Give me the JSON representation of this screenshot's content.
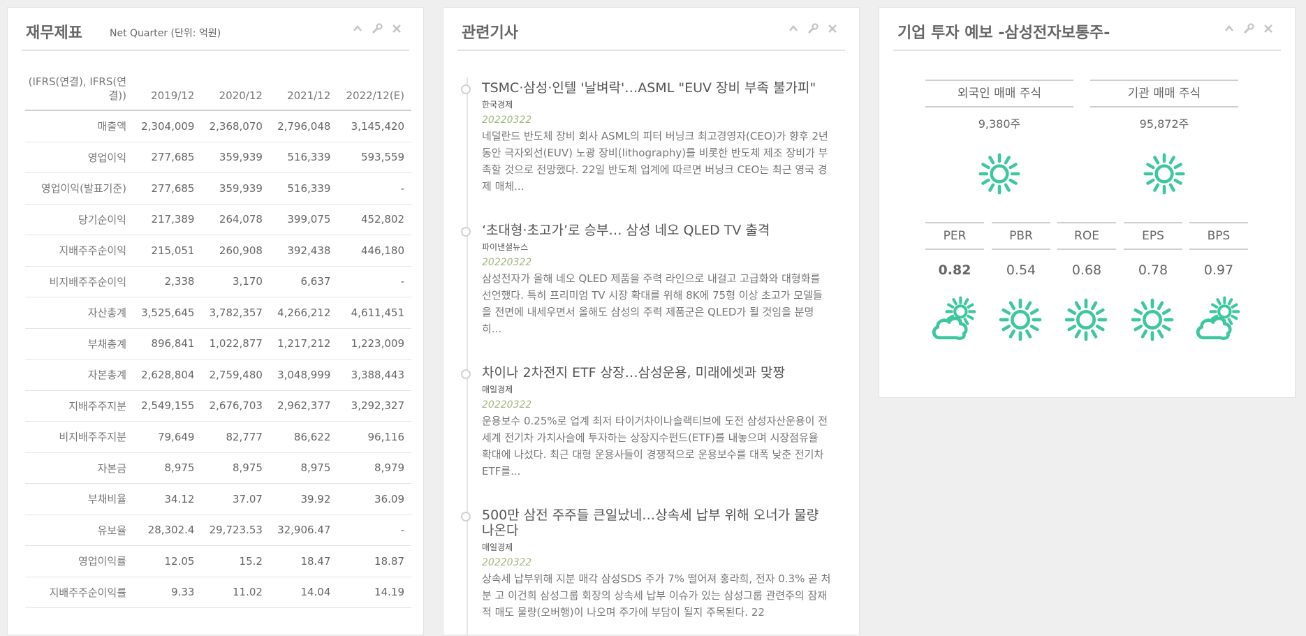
{
  "financial": {
    "title": "재무제표",
    "subtitle": "Net Quarter (단위: 억원)",
    "header_label": "(IFRS(연결), IFRS(연결))",
    "columns": [
      "2019/12",
      "2020/12",
      "2021/12",
      "2022/12(E)"
    ],
    "rows": [
      {
        "label": "매출액",
        "values": [
          "2,304,009",
          "2,368,070",
          "2,796,048",
          "3,145,420"
        ]
      },
      {
        "label": "영업이익",
        "values": [
          "277,685",
          "359,939",
          "516,339",
          "593,559"
        ]
      },
      {
        "label": "영업이익(발표기준)",
        "values": [
          "277,685",
          "359,939",
          "516,339",
          "-"
        ]
      },
      {
        "label": "당기순이익",
        "values": [
          "217,389",
          "264,078",
          "399,075",
          "452,802"
        ]
      },
      {
        "label": "지배주주순이익",
        "values": [
          "215,051",
          "260,908",
          "392,438",
          "446,180"
        ]
      },
      {
        "label": "비지배주주순이익",
        "values": [
          "2,338",
          "3,170",
          "6,637",
          "-"
        ]
      },
      {
        "label": "자산총계",
        "values": [
          "3,525,645",
          "3,782,357",
          "4,266,212",
          "4,611,451"
        ]
      },
      {
        "label": "부채총계",
        "values": [
          "896,841",
          "1,022,877",
          "1,217,212",
          "1,223,009"
        ]
      },
      {
        "label": "자본총계",
        "values": [
          "2,628,804",
          "2,759,480",
          "3,048,999",
          "3,388,443"
        ]
      },
      {
        "label": "지배주주지분",
        "values": [
          "2,549,155",
          "2,676,703",
          "2,962,377",
          "3,292,327"
        ]
      },
      {
        "label": "비지배주주지분",
        "values": [
          "79,649",
          "82,777",
          "86,622",
          "96,116"
        ]
      },
      {
        "label": "자본금",
        "values": [
          "8,975",
          "8,975",
          "8,975",
          "8,979"
        ]
      },
      {
        "label": "부채비율",
        "values": [
          "34.12",
          "37.07",
          "39.92",
          "36.09"
        ]
      },
      {
        "label": "유보율",
        "values": [
          "28,302.4",
          "29,723.53",
          "32,906.47",
          "-"
        ]
      },
      {
        "label": "영업이익률",
        "values": [
          "12.05",
          "15.2",
          "18.47",
          "18.87"
        ]
      },
      {
        "label": "지배주주순이익률",
        "values": [
          "9.33",
          "11.02",
          "14.04",
          "14.19"
        ]
      }
    ]
  },
  "news": {
    "title": "관련기사",
    "items": [
      {
        "title": "TSMC·삼성·인텔 '날벼락'…ASML \"EUV 장비 부족 불가피\"",
        "source": "한국경제",
        "date": "20220322",
        "body": "네덜란드 반도체 장비 회사 ASML의 피터 버닝크 최고경영자(CEO)가 향후 2년 동안 극자외선(EUV) 노광 장비(lithography)를 비롯한 반도체 제조 장비가 부족할 것으로 전망했다. 22일 반도체 업계에 따르면 버닝크 CEO는 최근 영국 경제 매체..."
      },
      {
        "title": "‘초대형·초고가’로 승부… 삼성 네오 QLED TV 출격",
        "source": "파이낸셜뉴스",
        "date": "20220322",
        "body": "삼성전자가 올해 네오 QLED 제품을 주력 라인으로 내걸고 고급화와 대형화를 선언했다. 특히 프리미엄 TV 시장 확대를 위해 8K에 75형 이상 초고가 모델들을 전면에 내세우면서 올해도 삼성의 주력 제품군은 QLED가 될 것임을 분명히..."
      },
      {
        "title": "차이나 2차전지 ETF 상장…삼성운용, 미래에셋과 맞짱",
        "source": "매일경제",
        "date": "20220322",
        "body": "운용보수 0.25%로 업계 최저 타이거차이나솔랙티브에 도전 삼성자산운용이 전 세계 전기차 가치사슬에 투자하는 상장지수펀드(ETF)를 내놓으며 시장점유율 확대에 나섰다. 최근 대형 운용사들이 경쟁적으로 운용보수를 대폭 낮춘 전기차 ETF를..."
      },
      {
        "title": "500만 삼전 주주들 큰일났네…상속세 납부 위해 오너가 물량 나온다",
        "source": "매일경제",
        "date": "20220322",
        "body": "상속세 납부위해 지분 매각 삼성SDS 주가 7% 떨어져 홍라희, 전자 0.3% 곧 처분 고 이건희 삼성그룹 회장의 상속세 납부 이슈가 있는 삼성그룹 관련주의 잠재적 매도 물량(오버행)이 나오며 주가에 부담이 될지 주목된다. 22"
      }
    ]
  },
  "forecast": {
    "title": "기업 투자 예보 -삼성전자보통주-",
    "trades": [
      {
        "label": "외국인 매매 주식",
        "value": "9,380주",
        "icon": "sun-icon"
      },
      {
        "label": "기관 매매 주식",
        "value": "95,872주",
        "icon": "sun-icon"
      }
    ],
    "metrics": [
      {
        "label": "PER",
        "value": "0.82",
        "icon": "cloud-sun-icon",
        "bold": true
      },
      {
        "label": "PBR",
        "value": "0.54",
        "icon": "sun-icon",
        "bold": false
      },
      {
        "label": "ROE",
        "value": "0.68",
        "icon": "sun-icon",
        "bold": false
      },
      {
        "label": "EPS",
        "value": "0.78",
        "icon": "sun-icon",
        "bold": false
      },
      {
        "label": "BPS",
        "value": "0.97",
        "icon": "cloud-sun-icon",
        "bold": false
      }
    ],
    "icon_color": "#3cc7a0"
  },
  "colors": {
    "background": "#efefef",
    "panel": "#ffffff",
    "date": "#9fb87d",
    "accent": "#3cc7a0"
  }
}
